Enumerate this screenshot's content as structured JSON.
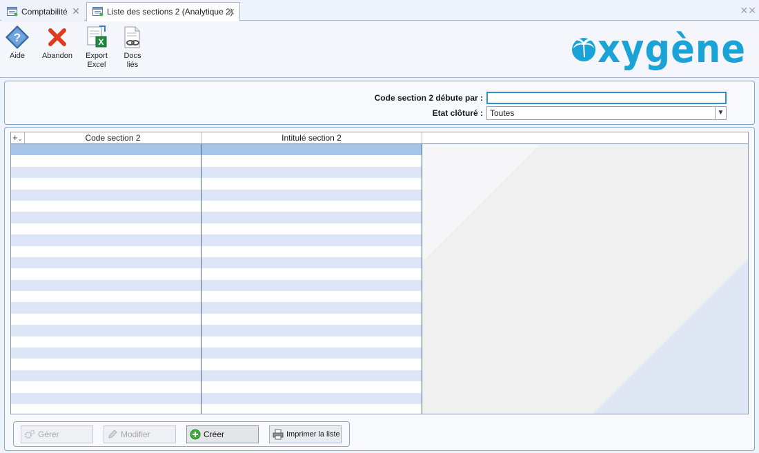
{
  "tabs": [
    {
      "label": "Comptabilité",
      "active": false
    },
    {
      "label": "Liste des sections 2 (Analytique 2)",
      "active": true
    }
  ],
  "toolbar": {
    "aide": "Aide",
    "abandon": "Abandon",
    "export_line1": "Export",
    "export_line2": "Excel",
    "docs_line1": "Docs",
    "docs_line2": "liés"
  },
  "logo_text": "oxygène",
  "filters": {
    "code_label": "Code section 2 débute par :",
    "code_value": "",
    "etat_label": "Etat clôturé :",
    "etat_value": "Toutes"
  },
  "grid": {
    "columns": [
      "Code section 2",
      "Intitulé section 2"
    ],
    "rows": []
  },
  "buttons": {
    "gerer": "Gérer",
    "modifier": "Modifier",
    "creer": "Créer",
    "imprimer": "Imprimer la liste"
  },
  "colors": {
    "accent": "#2f8fcf",
    "logo": "#1aa3d6",
    "row_alt": "#dce6f6",
    "row_selected": "#a6c4e8"
  }
}
